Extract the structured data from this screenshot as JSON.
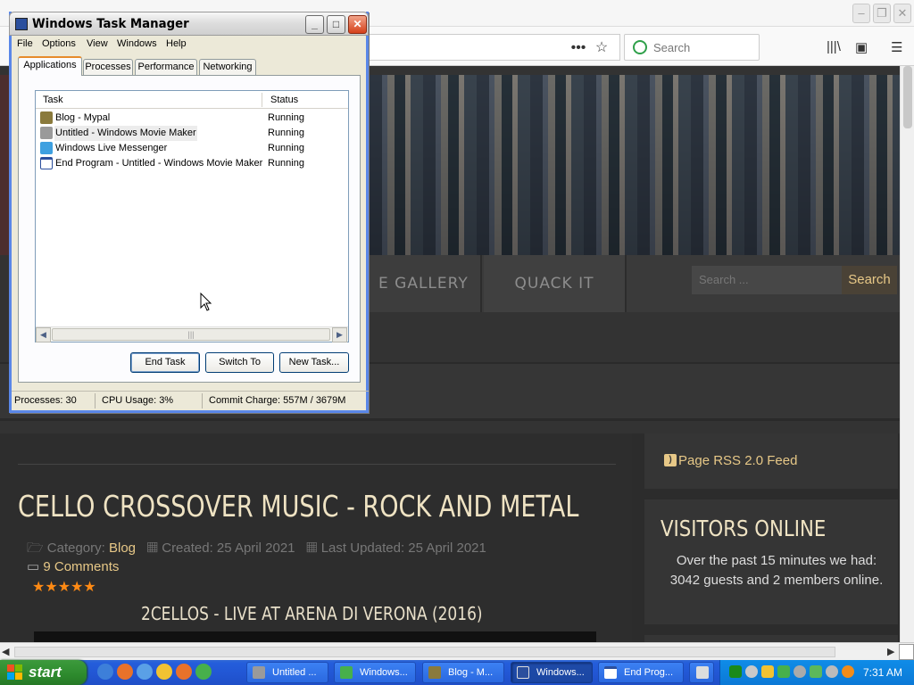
{
  "browser": {
    "search_placeholder": "Search",
    "banner": {
      "nav_gallery": "E GALLERY",
      "nav_quack": "QUACK IT",
      "site_search_placeholder": "Search ...",
      "site_search_button": "Search"
    },
    "article": {
      "title": "CELLO CROSSOVER MUSIC - ROCK AND METAL",
      "category_label": "Category:",
      "category_value": "Blog",
      "created": "Created: 25 April 2021",
      "updated": "Last Updated: 25 April 2021",
      "comments": "9 Comments",
      "stars": "★★★★★",
      "video_title": "2CELLOS - LIVE AT ARENA DI VERONA (2016)"
    },
    "sidebar": {
      "rss": "Page RSS 2.0 Feed",
      "visitors_title": "VISITORS ONLINE",
      "visitors_text": "Over the past 15 minutes we had: 3042 guests and 2 members online."
    }
  },
  "task_manager": {
    "title": "Windows Task Manager",
    "menu": [
      "File",
      "Options",
      "View",
      "Windows",
      "Help"
    ],
    "tabs": [
      "Applications",
      "Processes",
      "Performance",
      "Networking"
    ],
    "columns": [
      "Task",
      "Status"
    ],
    "rows": [
      {
        "task": "Blog - Mypal",
        "status": "Running"
      },
      {
        "task": "Untitled - Windows Movie Maker",
        "status": "Running"
      },
      {
        "task": "Windows Live Messenger",
        "status": "Running"
      },
      {
        "task": "End Program - Untitled - Windows Movie Maker",
        "status": "Running"
      }
    ],
    "buttons": {
      "end_task": "End Task",
      "switch_to": "Switch To",
      "new_task": "New Task..."
    },
    "status": {
      "processes": "Processes: 30",
      "cpu": "CPU Usage: 3%",
      "commit": "Commit Charge: 557M / 3679M"
    }
  },
  "taskbar": {
    "start": "start",
    "buttons": [
      "Untitled ...",
      "Windows...",
      "Blog - M...",
      "Windows...",
      "End Prog..."
    ],
    "clock": "7:31 AM"
  }
}
